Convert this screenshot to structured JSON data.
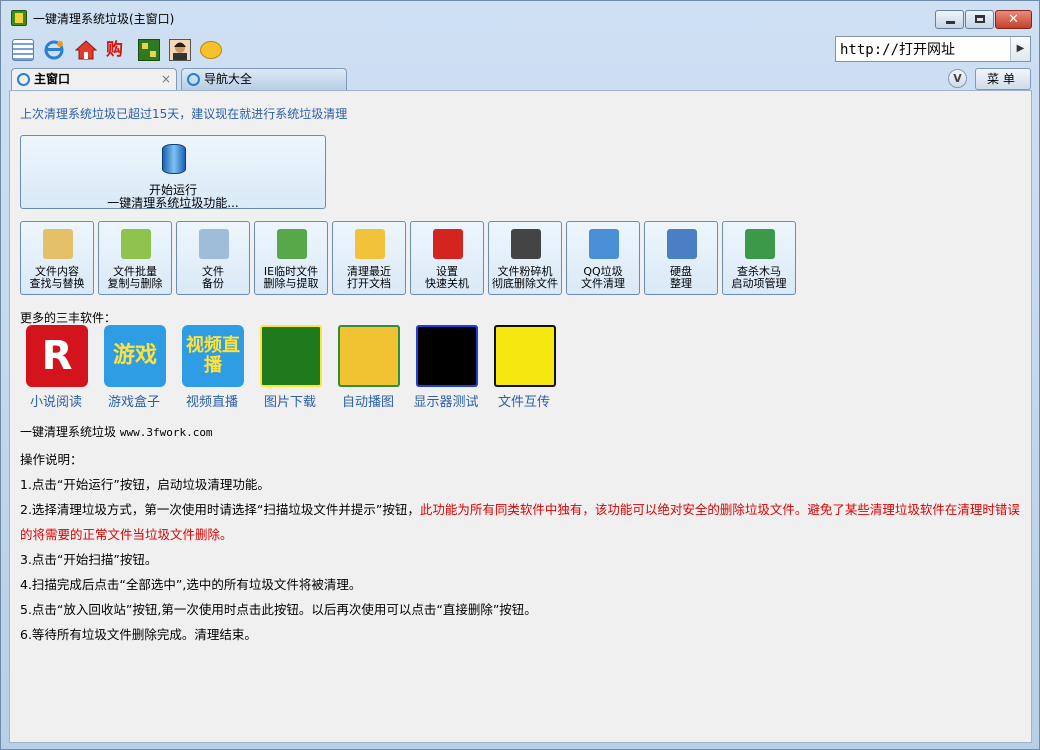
{
  "window": {
    "title": "一键清理系统垃圾(主窗口)",
    "close_glyph": "✕"
  },
  "address": {
    "value": "http://打开网址",
    "go_glyph": "▶"
  },
  "tabs": [
    {
      "label": "主窗口",
      "close": "×"
    },
    {
      "label": "导航大全"
    }
  ],
  "tabbar": {
    "chevron": "V",
    "menu_label": "菜单"
  },
  "notice": "上次清理系统垃圾已超过15天，建议现在就进行系统垃圾清理",
  "start_button": {
    "line1": "开始运行",
    "line2": "一键清理系统垃圾功能..."
  },
  "tools": [
    {
      "line1": "文件内容",
      "line2": "查找与替换",
      "icon": "magnifier-document-icon",
      "color": "#e4c06a"
    },
    {
      "line1": "文件批量",
      "line2": "复制与删除",
      "icon": "wrench-icon",
      "color": "#8fc34d"
    },
    {
      "line1": "文件",
      "line2": "备份",
      "icon": "file-copy-icon",
      "color": "#9fbcd8"
    },
    {
      "line1": "IE临时文件",
      "line2": "删除与提取",
      "icon": "recycle-bin-icon",
      "color": "#57a84a"
    },
    {
      "line1": "清理最近",
      "line2": "打开文档",
      "icon": "folder-icon",
      "color": "#f2c23b"
    },
    {
      "line1": "设置",
      "line2": "快速关机",
      "icon": "power-icon",
      "color": "#d5231e"
    },
    {
      "line1": "文件粉碎机",
      "line2": "彻底删除文件",
      "icon": "bomb-icon",
      "color": "#444444"
    },
    {
      "line1": "QQ垃圾",
      "line2": "文件清理",
      "icon": "penguin-icon",
      "color": "#4a90d6"
    },
    {
      "line1": "硬盘",
      "line2": "整理",
      "icon": "hard-disk-icon",
      "color": "#4b7fc4"
    },
    {
      "line1": "查杀木马",
      "line2": "启动项管理",
      "icon": "shield-ball-icon",
      "color": "#3b9a4a"
    }
  ],
  "more_label": "更多的三丰软件：",
  "apps": [
    {
      "name": "小说阅读",
      "icon": "letter-r-icon",
      "glyph": "R",
      "bg": "#d4141c",
      "fg": "#ffffff"
    },
    {
      "name": "游戏盒子",
      "icon": "game-box-icon",
      "glyph": "游戏",
      "bg": "#2f9de4",
      "fg": "#ffe23a"
    },
    {
      "name": "视频直播",
      "icon": "video-live-icon",
      "glyph": "视频直播",
      "bg": "#2f9de4",
      "fg": "#ffe23a"
    },
    {
      "name": "图片下载",
      "icon": "download-arrows-icon",
      "glyph": "",
      "bg": "#1f7a1e",
      "fg": "#ffe23a"
    },
    {
      "name": "自动播图",
      "icon": "easel-picture-icon",
      "glyph": "",
      "bg": "#f1c232",
      "fg": "#2f8f3a"
    },
    {
      "name": "显示器测试",
      "icon": "monitor-test-icon",
      "glyph": "",
      "bg": "#000000",
      "fg": "#1f3fd8"
    },
    {
      "name": "文件互传",
      "icon": "horse-icon",
      "glyph": "",
      "bg": "#f6e711",
      "fg": "#111111"
    }
  ],
  "brand": {
    "name": "一键清理系统垃圾",
    "url": "www.3fwork.com"
  },
  "instructions": {
    "title": "操作说明：",
    "step1": "1.点击“开始运行”按钮，启动垃圾清理功能。",
    "step2_normal": "2.选择清理垃圾方式，第一次使用时请选择“扫描垃圾文件并提示”按钮，",
    "step2_red": "此功能为所有同类软件中独有，该功能可以绝对安全的删除垃圾文件。避免了某些清理垃圾软件在清理时错误的将需要的正常文件当垃圾文件删除。",
    "step3": "3.点击“开始扫描”按钮。",
    "step4": "4.扫描完成后点击“全部选中”,选中的所有垃圾文件将被清理。",
    "step5": "5.点击“放入回收站”按钮,第一次使用时点击此按钮。以后再次使用可以点击“直接删除”按钮。",
    "step6": "6.等待所有垃圾文件删除完成。清理结束。"
  }
}
